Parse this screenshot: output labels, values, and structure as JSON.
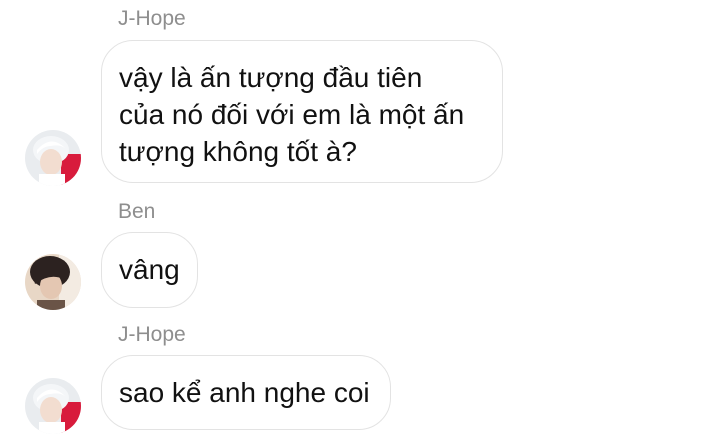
{
  "messages": [
    {
      "sender": "J-Hope",
      "avatar_icon": "avatar-jhope",
      "lines": [
        "vậy là ấn tượng đầu tiên",
        "của nó đối với em là một ấn",
        "tượng không tốt à?"
      ]
    },
    {
      "sender": "Ben",
      "avatar_icon": "avatar-ben",
      "lines": [
        "vâng"
      ]
    },
    {
      "sender": "J-Hope",
      "avatar_icon": "avatar-jhope",
      "lines": [
        "sao kể anh nghe coi"
      ]
    }
  ],
  "colors": {
    "sender_name": "#8e8e8e",
    "bubble_border": "#e3e3e3",
    "bubble_text": "#111111",
    "background": "#ffffff"
  }
}
